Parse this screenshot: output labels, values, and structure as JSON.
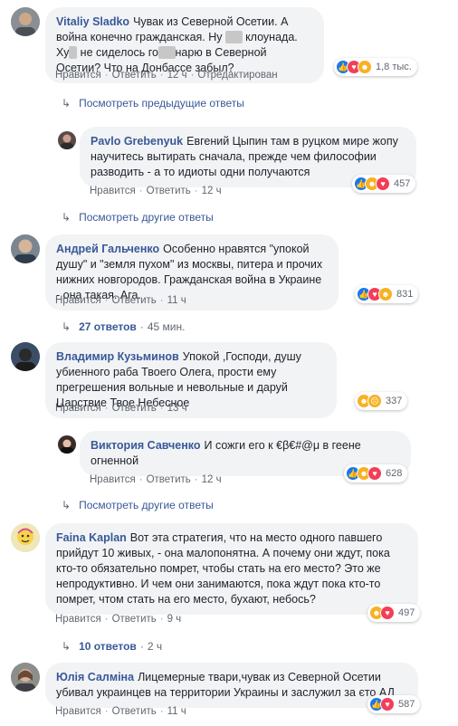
{
  "comments": [
    {
      "id": "c1",
      "author": "Vitaliy Sladko",
      "text_parts": [
        "Чувак из Северной Осетии. А война конечно гражданская. Ну ",
        "***",
        " клоунада. Ху",
        "*",
        " не сиделось го",
        "***",
        "нарю в Северной Осетии? Что на Донбассе забыл?"
      ],
      "actions": {
        "like": "Нравится",
        "reply": "Ответить",
        "time": "12 ч",
        "extra": "Отредактирован"
      },
      "reactions": {
        "types": [
          "like",
          "love",
          "haha"
        ],
        "count": "1,8 тыс."
      }
    },
    {
      "id": "c1r1",
      "author": "Pavlo Grebenyuk",
      "text": "Евгений Цыпин там в руцком мире жопу научитесь вытирать сначала, прежде чем философии разводить - а то идиоты одни получаются",
      "actions": {
        "like": "Нравится",
        "reply": "Ответить",
        "time": "12 ч"
      },
      "reactions": {
        "types": [
          "like",
          "haha",
          "love"
        ],
        "count": "457"
      }
    },
    {
      "id": "c2",
      "author": "Андрей Гальченко",
      "text": "Особенно нравятся \"упокой душу\" и \"земля пухом\" из москвы, питера и прочих нижних новгородов. Гражданская война в Украине - она такая. Ага.",
      "actions": {
        "like": "Нравится",
        "reply": "Ответить",
        "time": "11 ч"
      },
      "reactions": {
        "types": [
          "like",
          "love",
          "haha"
        ],
        "count": "831"
      }
    },
    {
      "id": "c3",
      "author": "Владимир Кузьминов",
      "text": "Упокой ,Господи, душу убиенного раба Твоего Олега, прости ему прегрешения вольные и невольные и даруй Царствие Твое Небесное",
      "actions": {
        "like": "Нравится",
        "reply": "Ответить",
        "time": "13 ч"
      },
      "reactions": {
        "types": [
          "haha",
          "sad"
        ],
        "count": "337"
      }
    },
    {
      "id": "c3r1",
      "author": "Виктория Савченко",
      "text": "И сожги его к €β€#@μ в геене огненной",
      "actions": {
        "like": "Нравится",
        "reply": "Ответить",
        "time": "12 ч"
      },
      "reactions": {
        "types": [
          "like",
          "haha",
          "love"
        ],
        "count": "628"
      }
    },
    {
      "id": "c4",
      "author": "Faina Kaplan",
      "text": "Вот эта стратегия, что на место одного павшего прийдут 10 живых, - она малопонятна. А почему они ждут, пока кто-то обязательно помрет, чтобы стать на его место? Это же непродуктивно. И чем они занимаются, пока ждут пока кто-то помрет, чтом стать на его место, бухают, небось?",
      "actions": {
        "like": "Нравится",
        "reply": "Ответить",
        "time": "9 ч"
      },
      "reactions": {
        "types": [
          "haha",
          "love"
        ],
        "count": "497"
      }
    },
    {
      "id": "c5",
      "author": "Юлія Салміна",
      "text": "Лицемерные твари,чувак из Северной Осетии убивал украинцев на территории Украины и заслужил за єто АД",
      "actions": {
        "like": "Нравится",
        "reply": "Ответить",
        "time": "11 ч"
      },
      "reactions": {
        "types": [
          "like",
          "love"
        ],
        "count": "587"
      }
    }
  ],
  "links": {
    "prev_replies": "Посмотреть предыдущие ответы",
    "other_replies_1": "Посмотреть другие ответы",
    "replies_27": "27 ответов",
    "replies_27_time": "45 мин.",
    "other_replies_2": "Посмотреть другие ответы",
    "replies_10": "10 ответов",
    "replies_10_time": "2 ч"
  },
  "colors": {
    "author": "#385898",
    "bubble": "#f2f3f5",
    "meta": "#606770",
    "like": "#1877f2",
    "love": "#f33e58",
    "haha": "#f7b125"
  },
  "icons": [
    "reply-arrow-icon",
    "like-reaction-icon",
    "love-reaction-icon",
    "haha-reaction-icon",
    "sad-reaction-icon"
  ]
}
